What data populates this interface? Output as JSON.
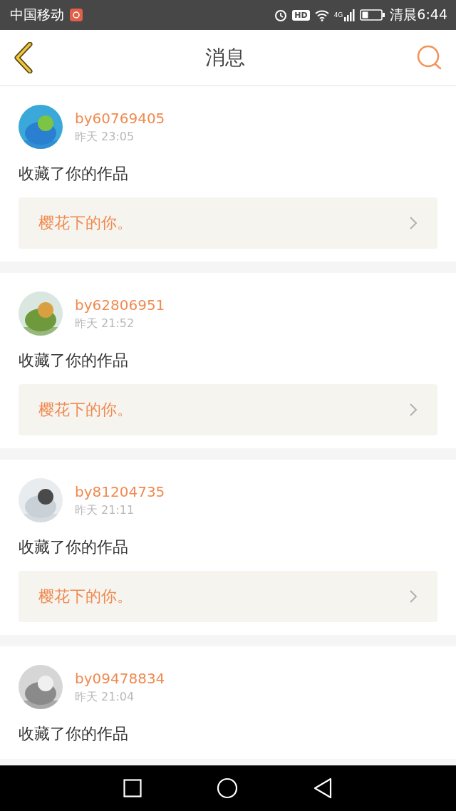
{
  "status_bar": {
    "carrier": "中国移动",
    "hd": "HD",
    "network": "4G",
    "time": "清晨6:44"
  },
  "header": {
    "title": "消息"
  },
  "messages": [
    {
      "user": "by60769405",
      "time": "昨天 23:05",
      "action": "收藏了你的作品",
      "work": "樱花下的你。"
    },
    {
      "user": "by62806951",
      "time": "昨天 21:52",
      "action": "收藏了你的作品",
      "work": "樱花下的你。"
    },
    {
      "user": "by81204735",
      "time": "昨天 21:11",
      "action": "收藏了你的作品",
      "work": "樱花下的你。"
    },
    {
      "user": "by09478834",
      "time": "昨天 21:04",
      "action": "收藏了你的作品"
    }
  ]
}
